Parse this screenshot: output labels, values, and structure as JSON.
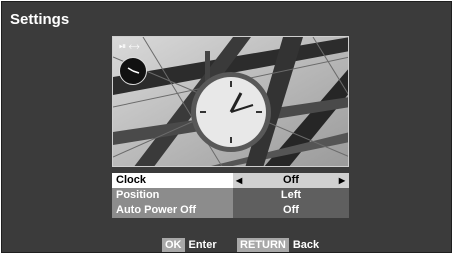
{
  "header": {
    "title": "Settings"
  },
  "preview": {
    "overlay_text": "⏯ ⟷"
  },
  "menu": {
    "rows": [
      {
        "label": "Clock",
        "value": "Off",
        "selected": true
      },
      {
        "label": "Position",
        "value": "Left",
        "selected": false
      },
      {
        "label": "Auto Power Off",
        "value": "Off",
        "selected": false
      }
    ]
  },
  "footer": {
    "ok_key": "OK",
    "ok_text": "Enter",
    "return_key": "RETURN",
    "return_text": "Back"
  },
  "icons": {
    "left_arrow": "left-arrow-icon",
    "right_arrow": "right-arrow-icon",
    "clock_overlay": "clock-icon"
  }
}
